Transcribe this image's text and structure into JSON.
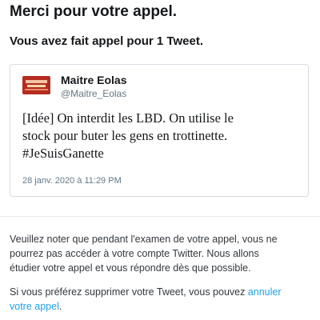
{
  "header": {
    "title": "Merci pour votre appel.",
    "subtitle": "Vous avez fait appel pour 1 Tweet."
  },
  "tweet": {
    "display_name": "Maitre Eolas",
    "handle": "@Maitre_Eolas",
    "text_lines": [
      "[Idée] On interdit les LBD. On utilise le",
      "stock pour buter les gens en trottinette.",
      "#JeSuisGanette"
    ],
    "timestamp": "28 janv. 2020 à 11:29 PM"
  },
  "notice": {
    "lines": [
      "Veuillez noter que pendant l'examen de votre appel, vous ne",
      "pourrez pas accéder à votre compte Twitter. Nous allons",
      "étudier votre appel et vous répondre dès que possible."
    ]
  },
  "delete_note": {
    "line1_text": "Si vous préférez supprimer votre Tweet, vous pouvez ",
    "link_part1": "annuler",
    "link_part2": "votre appel",
    "line2_end": "."
  },
  "colors": {
    "link": "#1da1f2",
    "secondary_text": "#657786",
    "border": "#d5dde3"
  }
}
